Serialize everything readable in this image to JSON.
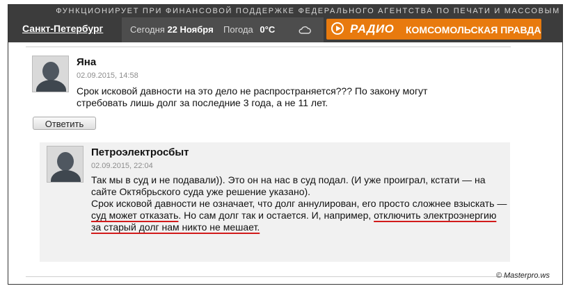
{
  "header": {
    "ticker": "ФУНКЦИОНИРУЕТ ПРИ ФИНАНСОВОЙ ПОДДЕРЖКЕ ФЕДЕРАЛЬНОГО АГЕНТСТВА ПО ПЕЧАТИ И МАССОВЫМ",
    "city": "Санкт-Петербург",
    "today_label": "Сегодня",
    "today_value": "22 Ноября",
    "weather_label": "Погода",
    "weather_value": "0°C",
    "weather_icon": "cloud-icon",
    "radio_word": "РАДИО",
    "radio_name": "КОМСОМОЛЬСКАЯ ПРАВДА"
  },
  "comment": {
    "author": "Яна",
    "date": "02.09.2015, 14:58",
    "text": "Срок исковой давности на это дело не распространяется??? По закону могут стребовать лишь долг за последние 3 года, а не 11 лет.",
    "reply_label": "Ответить"
  },
  "reply": {
    "author": "Петроэлектросбыт",
    "date": "02.09.2015, 22:04",
    "line1": "Так мы в суд и не подавали)). Это он на нас в суд подал. (И уже проиграл, кстати — на сайте Октябрьского суда уже решение указано).",
    "line2a": "Срок исковой давности не означает, что долг аннулирован, его просто сложнее взыскать — ",
    "line2b": "суд может отказать",
    "line2c": ". Но сам долг так и остается. И, например, ",
    "line2d": "отключить электроэнергию за старый долг нам никто не мешает."
  },
  "watermark": "© Masterpro.ws"
}
